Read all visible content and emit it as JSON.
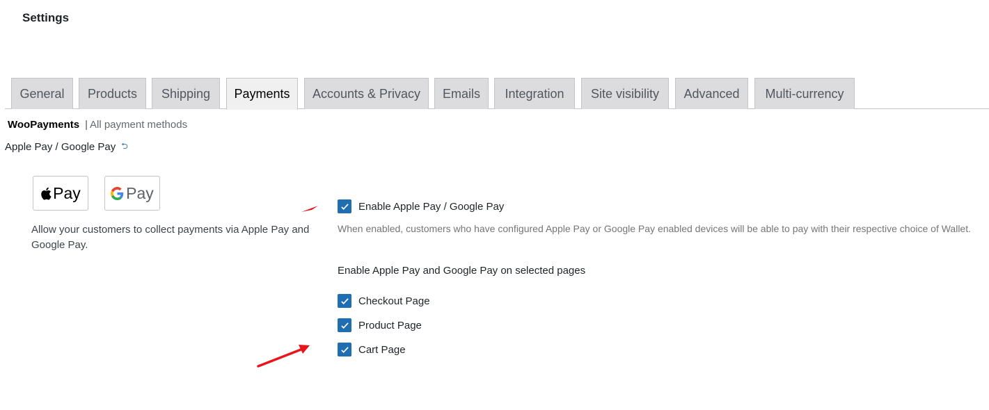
{
  "header": {
    "title": "Settings"
  },
  "tabs": [
    {
      "label": "General"
    },
    {
      "label": "Products"
    },
    {
      "label": "Shipping"
    },
    {
      "label": "Payments"
    },
    {
      "label": "Accounts & Privacy"
    },
    {
      "label": "Emails"
    },
    {
      "label": "Integration"
    },
    {
      "label": "Site visibility"
    },
    {
      "label": "Advanced"
    },
    {
      "label": "Multi-currency"
    }
  ],
  "active_tab": "Payments",
  "subnav": {
    "current": "WooPayments",
    "separator": "|",
    "link": "All payment methods"
  },
  "section": {
    "title": "Apple Pay / Google Pay",
    "back_icon": "return-arrow-icon"
  },
  "badges": {
    "apple": {
      "icon": "apple-logo-icon",
      "text": "Pay"
    },
    "google": {
      "icon": "google-g-logo-icon",
      "text": "Pay"
    }
  },
  "description": "Allow your customers to collect payments via Apple Pay and Google Pay.",
  "options": {
    "enable": {
      "label": "Enable Apple Pay / Google Pay",
      "checked": true
    },
    "help": "When enabled, customers who have configured Apple Pay or Google Pay enabled devices will be able to pay with their respective choice of Wallet.",
    "pages_heading": "Enable Apple Pay and Google Pay on selected pages",
    "pages": [
      {
        "label": "Checkout Page",
        "checked": true
      },
      {
        "label": "Product Page",
        "checked": true
      },
      {
        "label": "Cart Page",
        "checked": true
      }
    ]
  },
  "colors": {
    "checkbox": "#1e6eb1",
    "annotation_arrow": "#e8161b",
    "tab_bg": "#dcdcde"
  }
}
